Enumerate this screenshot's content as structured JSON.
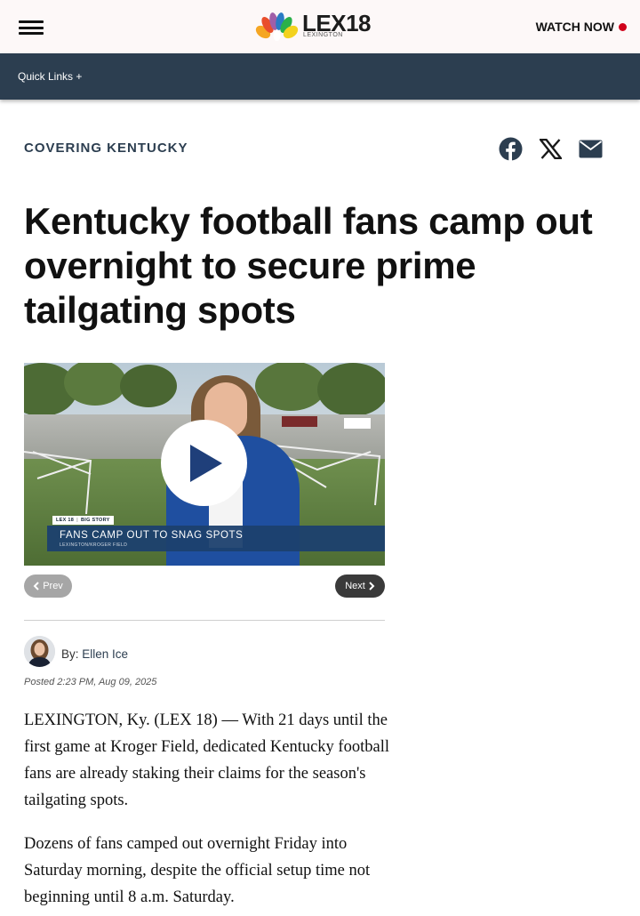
{
  "header": {
    "logo_text": "LEX18",
    "logo_sub": "LEXINGTON",
    "watch_now": "WATCH NOW"
  },
  "nav": {
    "quick_links": "Quick Links +"
  },
  "article": {
    "section": "COVERING KENTUCKY",
    "headline": "Kentucky football fans camp out overnight to secure prime tailgating spots",
    "video": {
      "lower_third_tag_station": "LEX 18",
      "lower_third_tag": "BIG STORY",
      "lower_third_title": "FANS CAMP OUT TO SNAG SPOTS",
      "lower_third_sub": "LEXINGTON/KROGER FIELD"
    },
    "prev_label": "Prev",
    "next_label": "Next",
    "byline_prefix": "By:",
    "author": "Ellen Ice",
    "posted": "Posted 2:23 PM, Aug 09, 2025",
    "paragraphs": [
      "LEXINGTON, Ky. (LEX 18) — With 21 days until the first game at Kroger Field, dedicated Kentucky football fans are already staking their claims for the season's tailgating spots.",
      "Dozens of fans camped out overnight Friday into Saturday morning, despite the official setup time not beginning until 8 a.m. Saturday."
    ]
  },
  "colors": {
    "nav_bg": "#2c3e50",
    "live_dot": "#d0021b",
    "section_label": "#2c3e50"
  },
  "icons": [
    "menu-icon",
    "nbc-peacock-icon",
    "facebook-icon",
    "x-icon",
    "email-icon",
    "play-icon",
    "chevron-left-icon",
    "chevron-right-icon"
  ]
}
